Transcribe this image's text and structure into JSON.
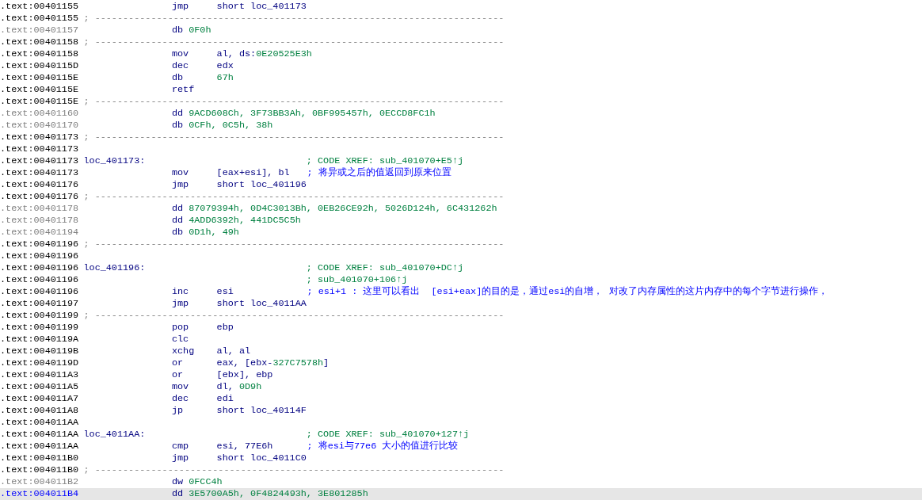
{
  "listing": [
    {
      "address": ".text:00401155",
      "kind": "insn",
      "selected": false,
      "mnemonic": "jmp",
      "operand": [
        {
          "text": "short loc_401173",
          "kind": "plain"
        }
      ]
    },
    {
      "address": ".text:00401155",
      "kind": "separator",
      "selected": false,
      "text": "; -------------------------------------------------------------------------"
    },
    {
      "address": ".text:00401157",
      "kind": "data",
      "selected": false,
      "mnemonic": "db",
      "operand": [
        {
          "text": "0F0h",
          "kind": "number"
        }
      ]
    },
    {
      "address": ".text:00401158",
      "kind": "separator",
      "selected": false,
      "text": "; -------------------------------------------------------------------------"
    },
    {
      "address": ".text:00401158",
      "kind": "insn",
      "selected": false,
      "mnemonic": "mov",
      "operand": [
        {
          "text": "al, ds:",
          "kind": "plain"
        },
        {
          "text": "0E20525E3h",
          "kind": "number"
        }
      ]
    },
    {
      "address": ".text:0040115D",
      "kind": "insn",
      "selected": false,
      "mnemonic": "dec",
      "operand": [
        {
          "text": "edx",
          "kind": "plain"
        }
      ]
    },
    {
      "address": ".text:0040115E",
      "kind": "insn",
      "selected": false,
      "mnemonic": "db",
      "operand": [
        {
          "text": "67h",
          "kind": "number"
        }
      ]
    },
    {
      "address": ".text:0040115E",
      "kind": "insn",
      "selected": false,
      "mnemonic": "retf"
    },
    {
      "address": ".text:0040115E",
      "kind": "separator",
      "selected": false,
      "text": "; -------------------------------------------------------------------------"
    },
    {
      "address": ".text:00401160",
      "kind": "data",
      "selected": false,
      "mnemonic": "dd",
      "operand": [
        {
          "text": "9ACD608Ch, 3F73BB3Ah, 0BF995457h, 0ECCD8FC1h",
          "kind": "number"
        }
      ]
    },
    {
      "address": ".text:00401170",
      "kind": "data",
      "selected": false,
      "mnemonic": "db",
      "operand": [
        {
          "text": "0CFh, 0C5h, 38h",
          "kind": "number"
        }
      ]
    },
    {
      "address": ".text:00401173",
      "kind": "separator",
      "selected": false,
      "text": "; -------------------------------------------------------------------------"
    },
    {
      "address": ".text:00401173",
      "kind": "blank",
      "selected": false
    },
    {
      "address": ".text:00401173",
      "kind": "label",
      "selected": false,
      "label": "loc_401173:",
      "comment": {
        "text": "; CODE XREF: sub_401070+E5↑j",
        "kind": "xref"
      }
    },
    {
      "address": ".text:00401173",
      "kind": "insn",
      "selected": false,
      "mnemonic": "mov",
      "operand": [
        {
          "text": "[eax+esi], bl",
          "kind": "plain"
        }
      ],
      "comment": {
        "text": "; 将异或之后的值返回到原来位置",
        "kind": "user"
      }
    },
    {
      "address": ".text:00401176",
      "kind": "insn",
      "selected": false,
      "mnemonic": "jmp",
      "operand": [
        {
          "text": "short loc_401196",
          "kind": "plain"
        }
      ]
    },
    {
      "address": ".text:00401176",
      "kind": "separator",
      "selected": false,
      "text": "; -------------------------------------------------------------------------"
    },
    {
      "address": ".text:00401178",
      "kind": "data",
      "selected": false,
      "mnemonic": "dd",
      "operand": [
        {
          "text": "87079394h, 0D4C3013Bh, 0EB26CE92h, 5026D124h, 6C431262h",
          "kind": "number"
        }
      ]
    },
    {
      "address": ".text:00401178",
      "kind": "data",
      "selected": false,
      "mnemonic": "dd",
      "operand": [
        {
          "text": "4ADD6392h, 441DC5C5h",
          "kind": "number"
        }
      ]
    },
    {
      "address": ".text:00401194",
      "kind": "data",
      "selected": false,
      "mnemonic": "db",
      "operand": [
        {
          "text": "0D1h, 49h",
          "kind": "number"
        }
      ]
    },
    {
      "address": ".text:00401196",
      "kind": "separator",
      "selected": false,
      "text": "; -------------------------------------------------------------------------"
    },
    {
      "address": ".text:00401196",
      "kind": "blank",
      "selected": false
    },
    {
      "address": ".text:00401196",
      "kind": "label",
      "selected": false,
      "label": "loc_401196:",
      "comment": {
        "text": "; CODE XREF: sub_401070+DC↑j",
        "kind": "xref"
      }
    },
    {
      "address": ".text:00401196",
      "kind": "label",
      "selected": false,
      "comment": {
        "text": "; sub_401070+106↑j",
        "kind": "xref"
      }
    },
    {
      "address": ".text:00401196",
      "kind": "insn",
      "selected": false,
      "mnemonic": "inc",
      "operand": [
        {
          "text": "esi",
          "kind": "plain"
        }
      ],
      "comment": {
        "text": "; esi+1 : 这里可以看出  [esi+eax]的目的是，通过esi的自增， 对改了内存属性的这片内存中的每个字节进行操作，",
        "kind": "user"
      }
    },
    {
      "address": ".text:00401197",
      "kind": "insn",
      "selected": false,
      "mnemonic": "jmp",
      "operand": [
        {
          "text": "short loc_4011AA",
          "kind": "plain"
        }
      ]
    },
    {
      "address": ".text:00401199",
      "kind": "separator",
      "selected": false,
      "text": "; -------------------------------------------------------------------------"
    },
    {
      "address": ".text:00401199",
      "kind": "insn",
      "selected": false,
      "mnemonic": "pop",
      "operand": [
        {
          "text": "ebp",
          "kind": "plain"
        }
      ]
    },
    {
      "address": ".text:0040119A",
      "kind": "insn",
      "selected": false,
      "mnemonic": "clc"
    },
    {
      "address": ".text:0040119B",
      "kind": "insn",
      "selected": false,
      "mnemonic": "xchg",
      "operand": [
        {
          "text": "al, al",
          "kind": "plain"
        }
      ]
    },
    {
      "address": ".text:0040119D",
      "kind": "insn",
      "selected": false,
      "mnemonic": "or",
      "operand": [
        {
          "text": "eax, [ebx-",
          "kind": "plain"
        },
        {
          "text": "327C7578h",
          "kind": "number"
        },
        {
          "text": "]",
          "kind": "plain"
        }
      ]
    },
    {
      "address": ".text:004011A3",
      "kind": "insn",
      "selected": false,
      "mnemonic": "or",
      "operand": [
        {
          "text": "[ebx], ebp",
          "kind": "plain"
        }
      ]
    },
    {
      "address": ".text:004011A5",
      "kind": "insn",
      "selected": false,
      "mnemonic": "mov",
      "operand": [
        {
          "text": "dl, ",
          "kind": "plain"
        },
        {
          "text": "0D9h",
          "kind": "number"
        }
      ]
    },
    {
      "address": ".text:004011A7",
      "kind": "insn",
      "selected": false,
      "mnemonic": "dec",
      "operand": [
        {
          "text": "edi",
          "kind": "plain"
        }
      ]
    },
    {
      "address": ".text:004011A8",
      "kind": "insn",
      "selected": false,
      "mnemonic": "jp",
      "operand": [
        {
          "text": "short loc_40114F",
          "kind": "plain"
        }
      ]
    },
    {
      "address": ".text:004011AA",
      "kind": "blank",
      "selected": false
    },
    {
      "address": ".text:004011AA",
      "kind": "label",
      "selected": false,
      "label": "loc_4011AA:",
      "comment": {
        "text": "; CODE XREF: sub_401070+127↑j",
        "kind": "xref"
      }
    },
    {
      "address": ".text:004011AA",
      "kind": "insn",
      "selected": false,
      "mnemonic": "cmp",
      "operand": [
        {
          "text": "esi, 77E6h",
          "kind": "plain"
        }
      ],
      "comment": {
        "text": "; 将esi与77e6 大小的值进行比较",
        "kind": "user"
      }
    },
    {
      "address": ".text:004011B0",
      "kind": "insn",
      "selected": false,
      "mnemonic": "jmp",
      "operand": [
        {
          "text": "short loc_4011C0",
          "kind": "plain"
        }
      ]
    },
    {
      "address": ".text:004011B0",
      "kind": "separator",
      "selected": false,
      "text": "; -------------------------------------------------------------------------"
    },
    {
      "address": ".text:004011B2",
      "kind": "data",
      "selected": false,
      "mnemonic": "dw",
      "operand": [
        {
          "text": "0FCC4h",
          "kind": "number"
        }
      ]
    },
    {
      "address": ".text:004011B4",
      "kind": "data",
      "selected": true,
      "mnemonic": "dd",
      "operand": [
        {
          "text": "3E5700A5h, 0F4824493h, 3E801285h",
          "kind": "number"
        }
      ]
    }
  ]
}
